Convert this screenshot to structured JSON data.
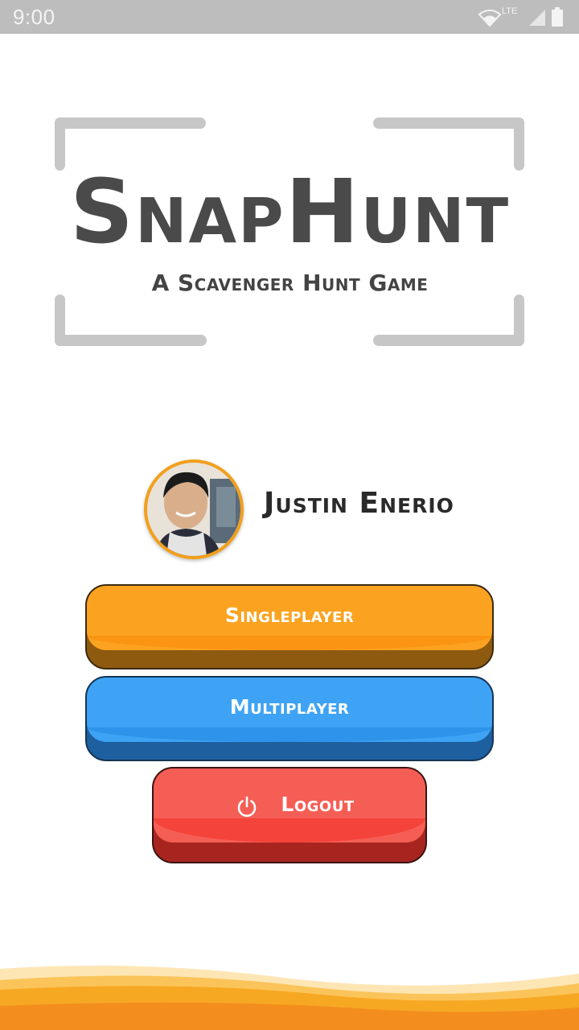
{
  "status_bar": {
    "time": "9:00",
    "network": "LTE",
    "icons": [
      "wifi-icon",
      "signal-icon",
      "battery-icon"
    ]
  },
  "logo": {
    "title": "SnapHunt",
    "subtitle": "A Scavenger Hunt Game"
  },
  "profile": {
    "name": "Justin Enerio"
  },
  "buttons": {
    "singleplayer": "Singleplayer",
    "multiplayer": "Multiplayer",
    "logout": "Logout"
  },
  "colors": {
    "singleplayer": "#fba320",
    "multiplayer": "#3ea3f4",
    "logout": "#f55e55",
    "avatar_ring": "#f29f1a",
    "wave": "#f7a823"
  }
}
